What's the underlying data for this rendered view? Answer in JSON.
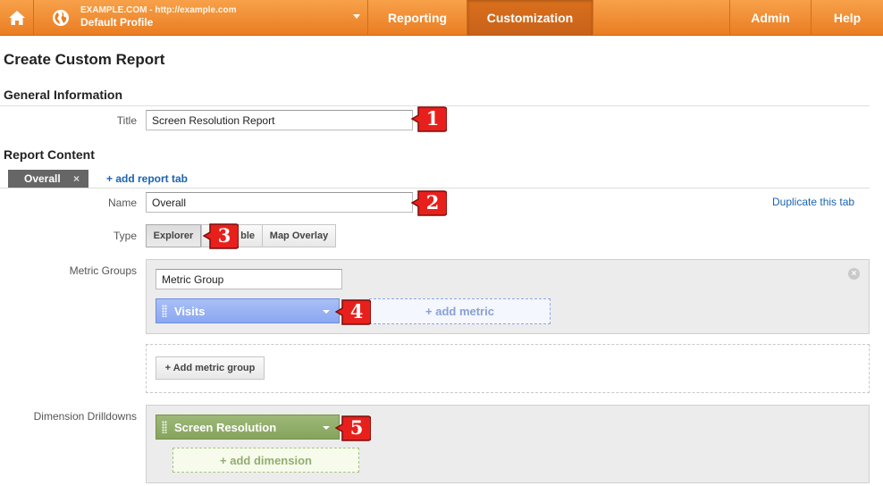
{
  "topbar": {
    "account": "EXAMPLE.COM - http://example.com",
    "profile": "Default Profile",
    "nav": {
      "reporting": "Reporting",
      "customization": "Customization",
      "admin": "Admin",
      "help": "Help"
    },
    "colors": {
      "bar": "#ea7d22",
      "active": "#c8621a"
    }
  },
  "page": {
    "title": "Create Custom Report",
    "general_heading": "General Information",
    "title_label": "Title",
    "title_value": "Screen Resolution Report",
    "content_heading": "Report Content",
    "tab_label": "Overall",
    "tab_close": "×",
    "add_tab": "+ add report tab",
    "duplicate_tab": "Duplicate this tab",
    "name_label": "Name",
    "name_value": "Overall",
    "type_label": "Type",
    "type_options": [
      "Explorer",
      "Flat Table",
      "Map Overlay"
    ],
    "type_visible": [
      "Explorer",
      "ble",
      "Map Overlay"
    ],
    "metric_groups_label": "Metric Groups",
    "metric_group_name": "Metric Group",
    "metric_chip": "Visits",
    "add_metric": "+ add metric",
    "add_metric_group": "+ Add metric group",
    "dimension_label": "Dimension Drilldowns",
    "dimension_chip": "Screen Resolution",
    "add_dimension": "+ add dimension"
  },
  "callouts": [
    "1",
    "2",
    "3",
    "4",
    "5"
  ]
}
